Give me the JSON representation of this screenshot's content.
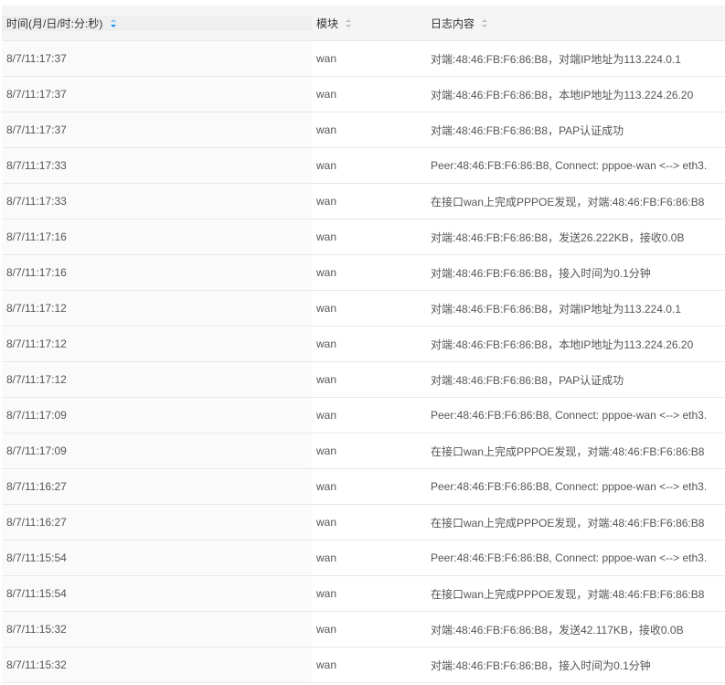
{
  "header": {
    "time": "时间(月/日/时:分:秒)",
    "module": "模块",
    "content": "日志内容"
  },
  "rows": [
    {
      "time": "8/7/11:17:37",
      "module": "wan",
      "content": "对端:48:46:FB:F6:86:B8，对端IP地址为113.224.0.1"
    },
    {
      "time": "8/7/11:17:37",
      "module": "wan",
      "content": "对端:48:46:FB:F6:86:B8，本地IP地址为113.224.26.20"
    },
    {
      "time": "8/7/11:17:37",
      "module": "wan",
      "content": "对端:48:46:FB:F6:86:B8，PAP认证成功"
    },
    {
      "time": "8/7/11:17:33",
      "module": "wan",
      "content": "Peer:48:46:FB:F6:86:B8, Connect: pppoe-wan <--> eth3."
    },
    {
      "time": "8/7/11:17:33",
      "module": "wan",
      "content": "在接口wan上完成PPPOE发现，对端:48:46:FB:F6:86:B8"
    },
    {
      "time": "8/7/11:17:16",
      "module": "wan",
      "content": "对端:48:46:FB:F6:86:B8，发送26.222KB，接收0.0B"
    },
    {
      "time": "8/7/11:17:16",
      "module": "wan",
      "content": "对端:48:46:FB:F6:86:B8，接入时间为0.1分钟"
    },
    {
      "time": "8/7/11:17:12",
      "module": "wan",
      "content": "对端:48:46:FB:F6:86:B8，对端IP地址为113.224.0.1"
    },
    {
      "time": "8/7/11:17:12",
      "module": "wan",
      "content": "对端:48:46:FB:F6:86:B8，本地IP地址为113.224.26.20"
    },
    {
      "time": "8/7/11:17:12",
      "module": "wan",
      "content": "对端:48:46:FB:F6:86:B8，PAP认证成功"
    },
    {
      "time": "8/7/11:17:09",
      "module": "wan",
      "content": "Peer:48:46:FB:F6:86:B8, Connect: pppoe-wan <--> eth3."
    },
    {
      "time": "8/7/11:17:09",
      "module": "wan",
      "content": "在接口wan上完成PPPOE发现，对端:48:46:FB:F6:86:B8"
    },
    {
      "time": "8/7/11:16:27",
      "module": "wan",
      "content": "Peer:48:46:FB:F6:86:B8, Connect: pppoe-wan <--> eth3."
    },
    {
      "time": "8/7/11:16:27",
      "module": "wan",
      "content": "在接口wan上完成PPPOE发现，对端:48:46:FB:F6:86:B8"
    },
    {
      "time": "8/7/11:15:54",
      "module": "wan",
      "content": "Peer:48:46:FB:F6:86:B8, Connect: pppoe-wan <--> eth3."
    },
    {
      "time": "8/7/11:15:54",
      "module": "wan",
      "content": "在接口wan上完成PPPOE发现，对端:48:46:FB:F6:86:B8"
    },
    {
      "time": "8/7/11:15:32",
      "module": "wan",
      "content": "对端:48:46:FB:F6:86:B8，发送42.117KB，接收0.0B"
    },
    {
      "time": "8/7/11:15:32",
      "module": "wan",
      "content": "对端:48:46:FB:F6:86:B8，接入时间为0.1分钟"
    }
  ],
  "colors": {
    "sort_active": "#1890ff",
    "header_bg": "#f5f5f5",
    "border": "#e8e8e8"
  }
}
